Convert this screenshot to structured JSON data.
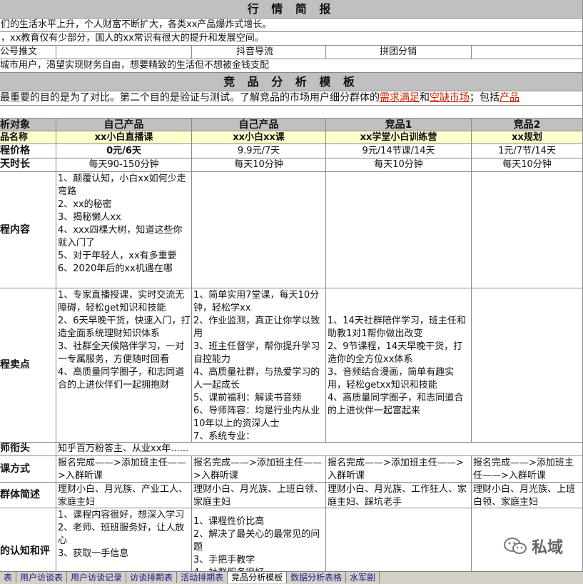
{
  "banner1": "行 情 简 报",
  "info_rows": [
    "们的生活水平上升，个人财富不断扩大，各类xx产品爆炸式增长。",
    "，xx教育仅有少部分，国人的xx常识有很大的提升和发展空间。"
  ],
  "channels": [
    "公号推文",
    "抖音导流",
    "拼团分销"
  ],
  "audience": "城市用户，渴望实现财务自由，想要精致的生活但不想被金钱支配",
  "banner2": "竞 品 分 析 模 板",
  "purpose_before": "最重要的目的是为了对比。第二个目的是验证与测试。了解竞品的市场用户细分群体的",
  "purpose_link1": "需求满足",
  "purpose_mid": "和",
  "purpose_link2": "空缺市场",
  "purpose_after": "；包括",
  "purpose_link3": "产品",
  "columns": {
    "label": "析对象",
    "c1": "自己产品",
    "c2": "自己产品",
    "c3": "竞品1",
    "c4": "竞品2"
  },
  "rows": {
    "name": {
      "label": "品名称",
      "c1": "xx小白直播课",
      "c2": "xx小白xx课",
      "c3": "xx学堂小白训练营",
      "c4": "xx规划"
    },
    "price": {
      "label": "程价格",
      "c1": "0元/6天",
      "c2": "9.9元/7天",
      "c3": "9元/14节课/14天",
      "c4": "1元/7节/14天"
    },
    "duration": {
      "label": "天时长",
      "c1": "每天90-150分钟",
      "c2": "每天10分钟",
      "c3": "每天10分钟",
      "c4": "每天10分钟"
    },
    "content": {
      "label": "程内容",
      "c1": "1、颠覆认知，小白xx如何少走弯路\n2、xx的秘密\n3、揭秘懒人xx\n4、xxx四棵大树，知道这些你就入门了\n5、对于年轻人，xx有多重要\n6、2020年后的xx机遇在哪"
    },
    "selling": {
      "label": "程卖点",
      "c1": "1、专家直播授课，实时交流无障碍，轻松get知识和技能\n2、6天早晚干货，快速入门，打造全面系统理财知识体系\n3、社群全天候陪伴学习，一对一专属服务，方便随时回看\n4、高质量同学圈子，和志同道合的上进伙伴们一起拥抱财",
      "c2": "1、简单实用7堂课，每天10分钟，轻松学xx\n2、作业监测，真正让你学以致用\n3、班主任督学，帮你提升学习自控能力\n4、高质量社群，与热爱学习的人一起成长\n5、课前福利：解读书音频\n6、导师阵容：均是行业内从业10年以上的资深人士\n7、系统专业：",
      "c3": "1、14天社群陪伴学习，班主任和助教1对1帮你做出改变\n2、9节课程，14天早晚干货，打造你的全方位xx体系\n3、音频结合漫画，简单有趣实用，轻松getxx知识和技能\n4、高质量同学圈子，和志同道合的上进伙伴一起富起来"
    },
    "teacher": {
      "label": "师衔头",
      "c1": "知乎百万粉答主、从业xx年......"
    },
    "method": {
      "label": "课方式",
      "c1": "报名完成——>添加班主任——>入群听课",
      "c2": "报名完成——>添加班主任——>入群听课",
      "c3": "报名完成——>添加班主任——>入群听课",
      "c4": "报名完成——>添加班主任——>入群听课"
    },
    "group": {
      "label": "群体简述",
      "c1": "理财小白、月光族、产业工人、家庭主妇",
      "c2": "理财小白、月光族、上班白领、家庭主妇",
      "c3": "理财小白、月光族、工作狂人、家庭主妇、踩坑老手",
      "c4": "理财小白、月光族、上班白领、家庭主妇"
    },
    "cognition": {
      "label": "的认知和评",
      "c1": "1、课程内容很好，想深入学习\n2、老师、班班服务好，让人放心\n3、获取一手信息",
      "c2": "1、课程性价比高\n2、解决了最关心的最常见的问题\n3、手把手教学\n4、社群服务很好"
    }
  },
  "sheet_tabs": [
    "表",
    "用户访谈表",
    "用户访谈记录",
    "访谈排期表",
    "活动排期表",
    "竞品分析模板",
    "数据分析表格",
    "水军剧"
  ],
  "active_tab": "竞品分析模板",
  "watermark": "私域"
}
